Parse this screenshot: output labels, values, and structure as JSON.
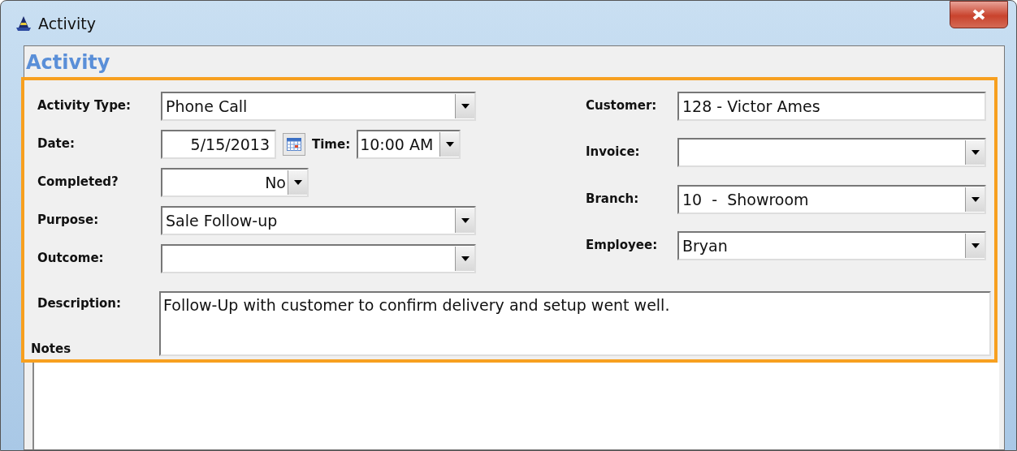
{
  "window": {
    "title": "Activity"
  },
  "heading": "Activity",
  "left_fields": [
    {
      "kind": "combo",
      "label": "Activity Type:",
      "value": "Phone Call"
    },
    {
      "kind": "date_time",
      "label": "Date:",
      "value": "5/15/2013",
      "time_label": "Time:",
      "time_value": "10:00 AM"
    },
    {
      "kind": "small_combo",
      "label": "Completed?",
      "value": "No"
    },
    {
      "kind": "combo",
      "label": "Purpose:",
      "value": "Sale Follow-up"
    },
    {
      "kind": "combo",
      "label": "Outcome:"
    }
  ],
  "right_fields": [
    {
      "kind": "text",
      "label": "Customer:",
      "value": "128 - Victor Ames"
    },
    {
      "kind": "combo",
      "label": "Invoice:"
    },
    {
      "kind": "combo",
      "label": "Branch:",
      "value": "10  -  Showroom"
    },
    {
      "kind": "combo",
      "label": "Employee:",
      "value": "Bryan"
    }
  ],
  "description": {
    "label": "Description:",
    "sublabel": "Notes",
    "value": "Follow-Up with customer to confirm delivery and setup went well."
  }
}
